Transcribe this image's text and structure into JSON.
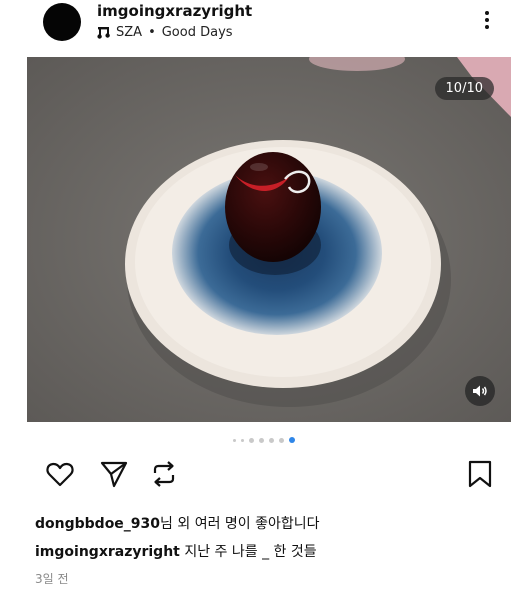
{
  "post": {
    "username": "imgoingxrazyright",
    "music": {
      "artist": "SZA",
      "separator": "•",
      "song": "Good Days"
    },
    "media": {
      "counter": "10/10",
      "current_slide": 10,
      "total_slides": 10
    },
    "likes": {
      "user": "dongbbdoe_930",
      "text": "님 외 여러 명이 좋아합니다"
    },
    "caption": {
      "user": "imgoingxrazyright",
      "text": "지난 주 나를 _ 한 것들"
    },
    "time_ago": "3일 전"
  },
  "icons": {
    "more": "more-vertical-icon",
    "music": "music-note-icon",
    "sound": "speaker-icon",
    "like": "heart-icon",
    "share": "send-icon",
    "repost": "repost-icon",
    "save": "bookmark-icon"
  },
  "colors": {
    "active_dot": "#2f86e8",
    "inactive_dot": "#c9c9c9"
  }
}
